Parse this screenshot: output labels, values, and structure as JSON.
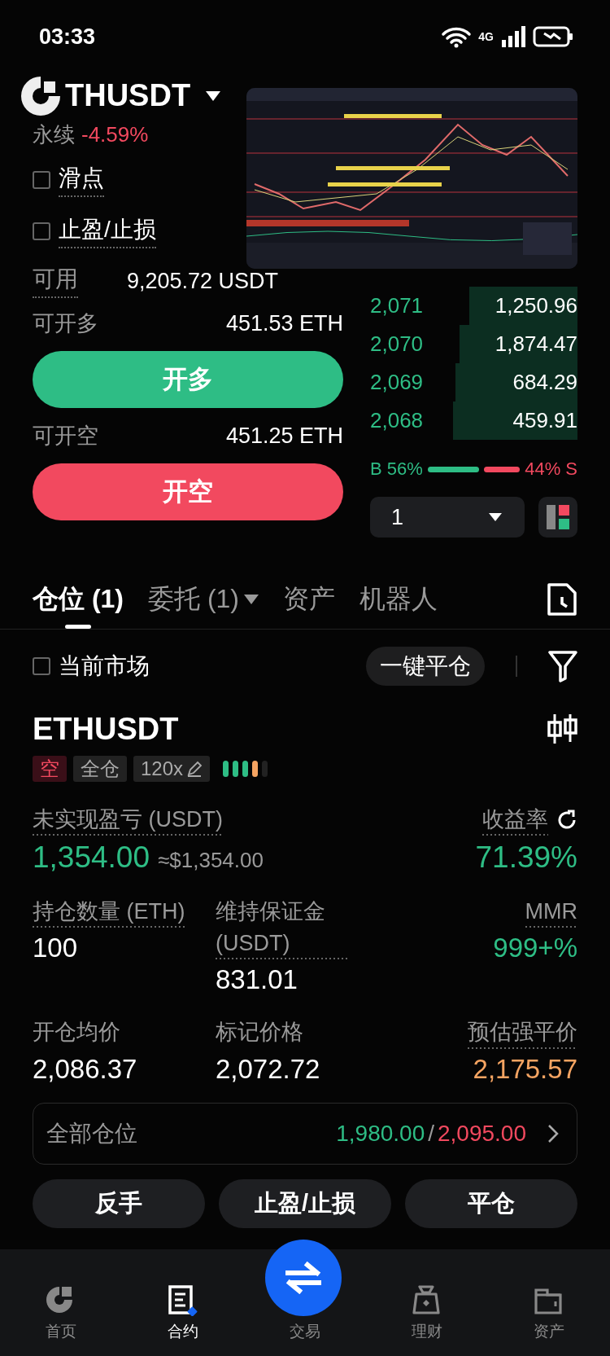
{
  "status_bar": {
    "time": "03:33",
    "network": "4G"
  },
  "header": {
    "symbol": "THUSDT",
    "contract_type": "永续",
    "change": "-4.59%"
  },
  "options": [
    {
      "label": "滑点",
      "checked": false
    },
    {
      "label": "止盈/止损",
      "checked": false
    }
  ],
  "available": {
    "label": "可用",
    "value": "9,205.72 USDT"
  },
  "open_long": {
    "label": "可开多",
    "value": "451.53 ETH",
    "button": "开多"
  },
  "open_short": {
    "label": "可开空",
    "value": "451.25 ETH",
    "button": "开空"
  },
  "order_book": {
    "rows": [
      {
        "price": "2,071",
        "amount": "1,250.96"
      },
      {
        "price": "2,070",
        "amount": "1,874.47"
      },
      {
        "price": "2,069",
        "amount": "684.29"
      },
      {
        "price": "2,068",
        "amount": "459.91"
      }
    ]
  },
  "ratio": {
    "buy_label": "B 56%",
    "sell_label": "44% S",
    "level": 0.56
  },
  "precision_select": {
    "value": "1"
  },
  "tabs": [
    {
      "label": "仓位 (1)",
      "selected": true,
      "dropdown": false
    },
    {
      "label": "委托 (1)",
      "selected": false,
      "dropdown": true
    },
    {
      "label": "资产",
      "selected": false,
      "dropdown": false
    },
    {
      "label": "机器人",
      "selected": false,
      "dropdown": false
    }
  ],
  "filter": {
    "label": "当前市场",
    "checked": false,
    "close_all": "一键平仓"
  },
  "position": {
    "symbol": "ETHUSDT",
    "side": "空",
    "is_short": true,
    "margin_mode": "全仓",
    "leverage": "120x",
    "risk_bars": [
      {
        "color": "#2ebd85"
      },
      {
        "color": "#2ebd85"
      },
      {
        "color": "#2ebd85"
      },
      {
        "color": "#f5a462"
      },
      {
        "color": "#222222"
      }
    ],
    "metrics": [
      {
        "label": "未实现盈亏 (USDT)",
        "value": "1,354.00",
        "sub": "≈$1,354.00",
        "color": "#2ebd85",
        "hint": true,
        "refresh": false
      },
      {
        "label": "收益率",
        "value": "71.39%",
        "color": "#2ebd85",
        "hint": true,
        "refresh": true
      },
      {
        "label": "持仓数量 (ETH)",
        "value": "100",
        "color": "#ffffff",
        "hint": true,
        "refresh": false
      },
      {
        "label": "维持保证金 (USDT)",
        "value": "831.01",
        "color": "#ffffff",
        "hint": true,
        "refresh": false
      },
      {
        "label": "MMR",
        "value": "999+%",
        "color": "#2ebd85",
        "hint": true,
        "refresh": false
      },
      {
        "label": "开仓均价",
        "value": "2,086.37",
        "color": "#ffffff",
        "hint": false,
        "refresh": false
      },
      {
        "label": "标记价格",
        "value": "2,072.72",
        "color": "#ffffff",
        "hint": false,
        "refresh": false
      },
      {
        "label": "预估强平价",
        "value": "2,175.57",
        "color": "#f5a462",
        "hint": true,
        "refresh": false
      }
    ]
  },
  "all_positions": {
    "label": "全部仓位",
    "long": "1,980.00",
    "separator": "/",
    "short": "2,095.00"
  },
  "actions": [
    "反手",
    "止盈/止损",
    "平仓"
  ],
  "nav": [
    {
      "label": "首页",
      "kind": "tab",
      "selected": false
    },
    {
      "label": "合约",
      "kind": "tab",
      "selected": true
    },
    {
      "label": "交易",
      "kind": "center",
      "selected": false
    },
    {
      "label": "理财",
      "kind": "tab",
      "selected": false
    },
    {
      "label": "资产",
      "kind": "tab",
      "selected": false
    }
  ]
}
